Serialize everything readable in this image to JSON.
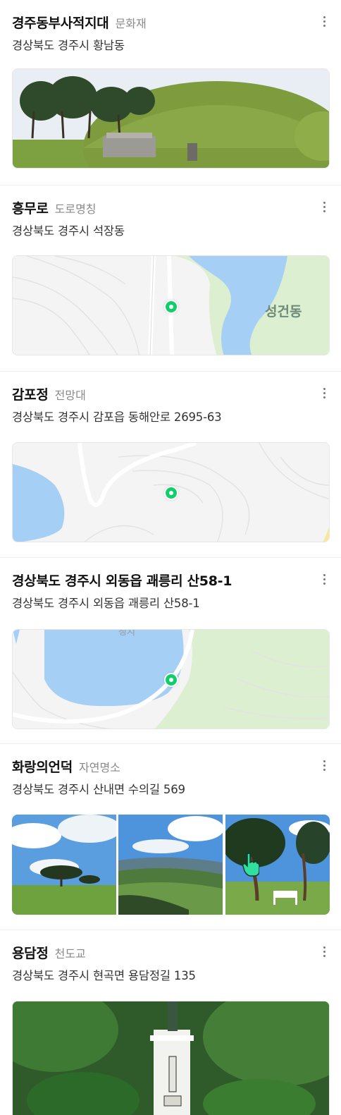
{
  "results": [
    {
      "name": "경주동부사적지대",
      "category": "문화재",
      "address": "경상북도 경주시 황남동"
    },
    {
      "name": "흥무로",
      "category": "도로명칭",
      "address": "경상북도 경주시 석장동",
      "map_label": "성건동"
    },
    {
      "name": "감포정",
      "category": "전망대",
      "address": "경상북도 경주시 감포읍 동해안로 2695-63"
    },
    {
      "name": "경상북도 경주시 외동읍 괘릉리 산58-1",
      "category": "",
      "address": "경상북도 경주시 외동읍 괘릉리 산58-1",
      "map_label": "정지"
    },
    {
      "name": "화랑의언덕",
      "category": "자연명소",
      "address": "경상북도 경주시 산내면 수의길 569"
    },
    {
      "name": "용담정",
      "category": "천도교",
      "address": "경상북도 경주시 현곡면 용담정길 135"
    }
  ],
  "colors": {
    "pin": "#0fcf6b",
    "water": "#a6cff5",
    "park": "#dcefd0"
  },
  "icons": {
    "more": "more-vertical-icon",
    "pin": "map-pin-icon",
    "cursor": "hand-pointer-icon"
  }
}
